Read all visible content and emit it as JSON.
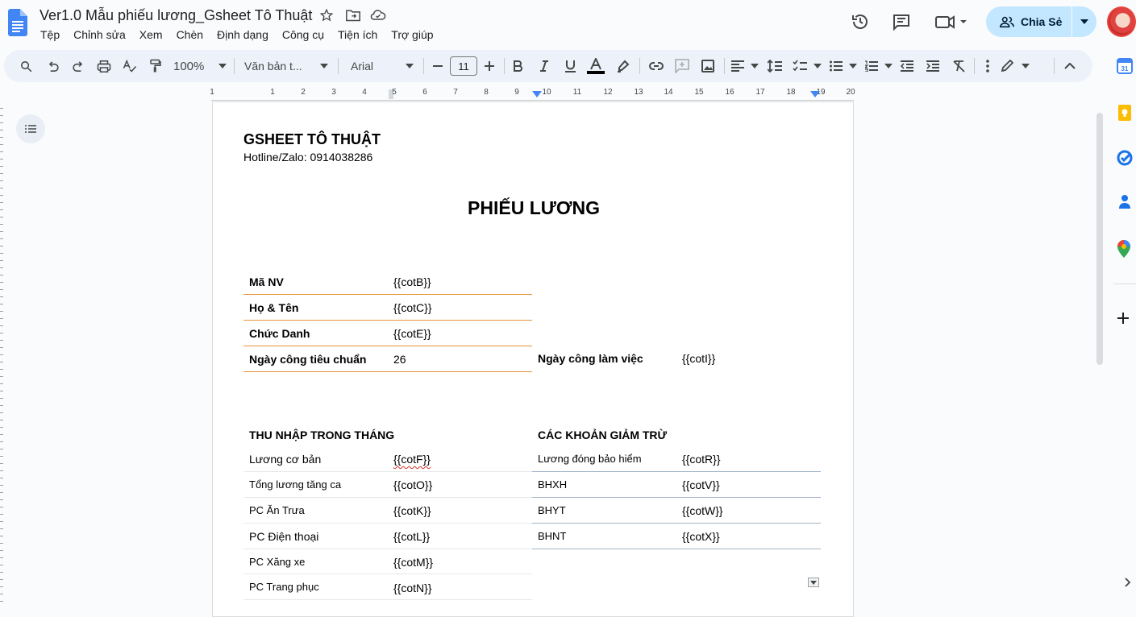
{
  "header": {
    "doc_title": "Ver1.0 Mẫu phiếu lương_Gsheet Tô Thuật",
    "menu": [
      "Tệp",
      "Chỉnh sửa",
      "Xem",
      "Chèn",
      "Định dạng",
      "Công cụ",
      "Tiện ích",
      "Trợ giúp"
    ],
    "share_label": "Chia Sẻ"
  },
  "toolbar": {
    "zoom": "100%",
    "style": "Văn bản t...",
    "font": "Arial",
    "font_size": "11"
  },
  "ruler": {
    "labels": [
      "1",
      "1",
      "2",
      "3",
      "4",
      "5",
      "6",
      "7",
      "8",
      "9",
      "10",
      "11",
      "12",
      "13",
      "14",
      "15",
      "16",
      "17",
      "18",
      "19",
      "20"
    ]
  },
  "document": {
    "company": "GSHEET TÔ THUẬT",
    "hotline": "Hotline/Zalo: 0914038286",
    "title": "PHIẾU LƯƠNG",
    "info": {
      "ma_nv_label": "Mã NV",
      "ma_nv_value": "{{cotB}}",
      "ho_ten_label": "Họ & Tên",
      "ho_ten_value": "{{cotC}}",
      "chuc_danh_label": "Chức Danh",
      "chuc_danh_value": "{{cotE}}",
      "ngay_cong_tc_label": "Ngày công tiêu chuẩn",
      "ngay_cong_tc_value": "26",
      "ngay_cong_lv_label": "Ngày công làm việc",
      "ngay_cong_lv_value": "{{cotI}}"
    },
    "income": {
      "header": "THU NHẬP TRONG THÁNG",
      "rows": [
        {
          "label": "Lương cơ bản",
          "value": "{{cotF}}"
        },
        {
          "label": "Tổng lương tăng ca",
          "value": "{{cotO}}"
        },
        {
          "label": "PC Ăn Trưa",
          "value": "{{cotK}}"
        },
        {
          "label": "PC Điện thoại",
          "value": "{{cotL}}"
        },
        {
          "label": "PC Xăng xe",
          "value": "{{cotM}}"
        },
        {
          "label": "PC Trang phục",
          "value": "{{cotN}}"
        }
      ]
    },
    "deductions": {
      "header": "CÁC KHOẢN GIẢM TRỪ",
      "rows": [
        {
          "label": "Lương đóng bảo hiểm",
          "value": "{{cotR}}"
        },
        {
          "label": "BHXH",
          "value": "{{cotV}}"
        },
        {
          "label": "BHYT",
          "value": "{{cotW}}"
        },
        {
          "label": "BHNT",
          "value": "{{cotX}}"
        }
      ]
    }
  }
}
